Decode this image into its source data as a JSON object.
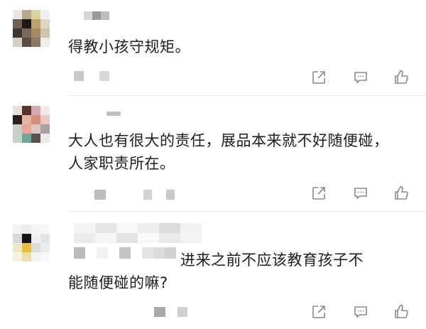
{
  "comments": [
    {
      "text": "得教小孩守规矩。",
      "icons": [
        "share-icon",
        "reply-icon",
        "like-icon"
      ]
    },
    {
      "text": "大人也有很大的责任，展品本来就不好随便碰，人家职责所在。",
      "icons": [
        "share-icon",
        "reply-icon",
        "like-icon"
      ]
    },
    {
      "text": "进来之前不应该教育孩子不能随便碰的嘛?",
      "icons": [
        "share-icon",
        "reply-icon",
        "like-icon"
      ]
    }
  ],
  "colors": {
    "text": "#1e1e1e",
    "icon": "#8a8a8a",
    "divider": "#ececec",
    "redacted": "#c9c9c9"
  }
}
